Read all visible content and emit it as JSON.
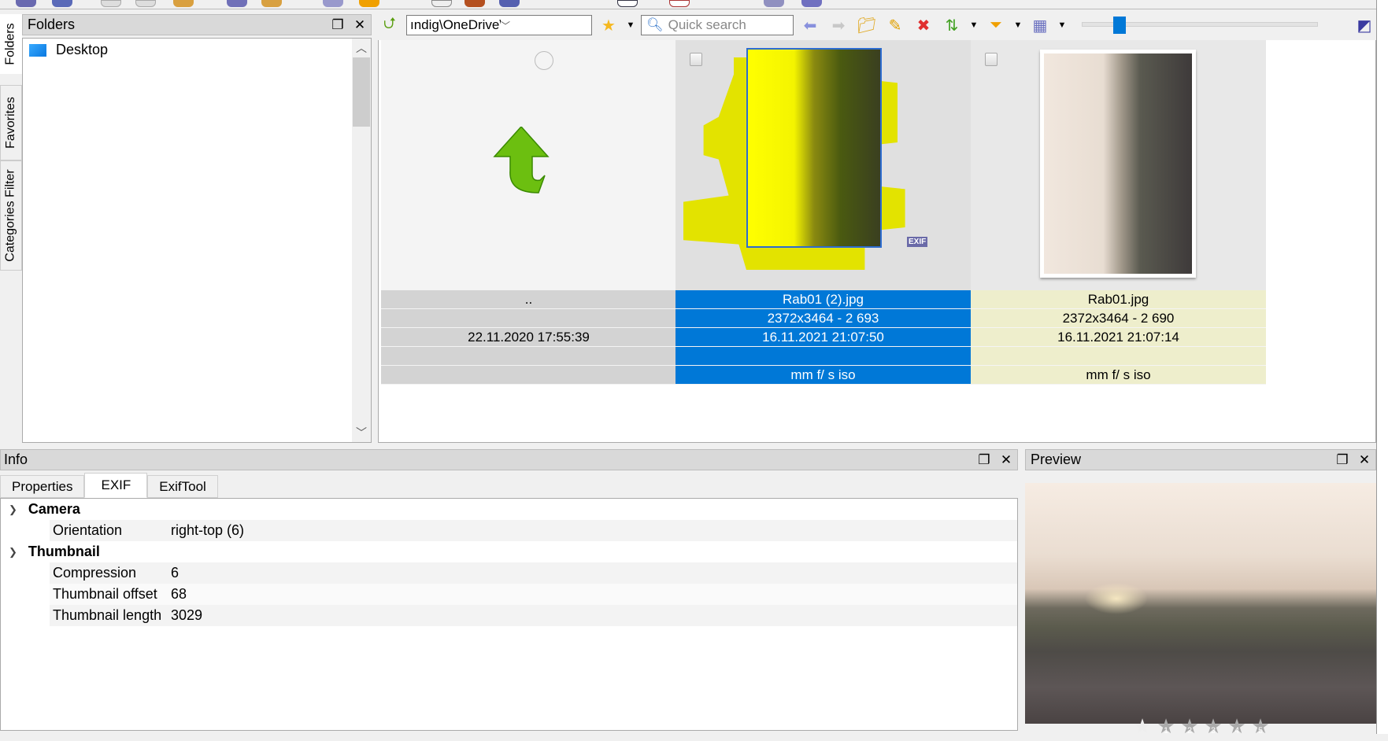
{
  "side_tabs": [
    "Folders",
    "Favorites",
    "Categories Filter"
  ],
  "folders_panel": {
    "title": "Folders",
    "items": [
      {
        "label": "Desktop"
      }
    ]
  },
  "toolbar": {
    "path": "ındig\\OneDrive\\Bilder\\Test\\",
    "search_placeholder": "Quick search",
    "zoom_slider_fraction": 0.14
  },
  "thumbnails": [
    {
      "name": "..",
      "dims": "",
      "date": "22.11.2020 17:55:39",
      "extra": "",
      "exif": "",
      "state": "parent"
    },
    {
      "name": "Rab01 (2).jpg",
      "dims": "2372x3464 - 2 693",
      "date": "16.11.2021 21:07:50",
      "extra": "",
      "exif": "mm f/ s iso",
      "state": "selected",
      "badge": "EXIF"
    },
    {
      "name": "Rab01.jpg",
      "dims": "2372x3464 - 2 690",
      "date": "16.11.2021 21:07:14",
      "extra": "",
      "exif": "mm f/ s iso",
      "state": "normal"
    }
  ],
  "info_panel": {
    "title": "Info",
    "tabs": [
      "Properties",
      "EXIF",
      "ExifTool"
    ],
    "active_tab": "EXIF",
    "groups": [
      {
        "name": "Camera",
        "props": [
          {
            "k": "Orientation",
            "v": "right-top (6)"
          }
        ]
      },
      {
        "name": "Thumbnail",
        "props": [
          {
            "k": "Compression",
            "v": "6"
          },
          {
            "k": "Thumbnail offset",
            "v": "68"
          },
          {
            "k": "Thumbnail length",
            "v": "3029"
          }
        ]
      }
    ]
  },
  "preview_panel": {
    "title": "Preview",
    "rating_labels": [
      "1",
      "2",
      "3",
      "4",
      "5"
    ]
  },
  "colors": {
    "selected": "#0078d7",
    "highlight_row": "#eeeecc",
    "parent_row": "#d3d3d3"
  }
}
